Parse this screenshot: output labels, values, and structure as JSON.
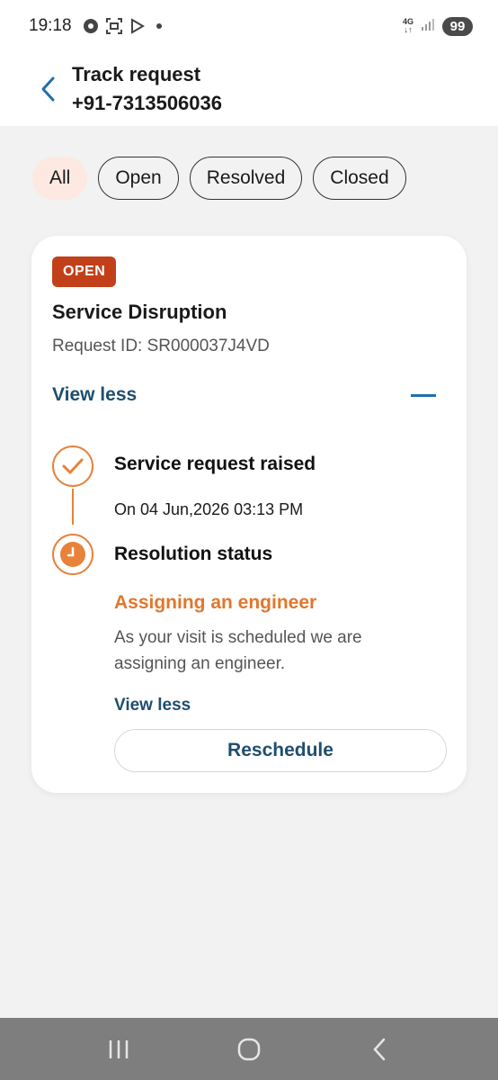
{
  "status_bar": {
    "time": "19:18",
    "network": "4G",
    "battery": "99",
    "icons": [
      "app-icon",
      "scan-icon",
      "play-store-icon",
      "notification-dot",
      "signal-icon"
    ]
  },
  "header": {
    "title": "Track request",
    "subtitle": "+91-7313506036",
    "back_icon": "chevron-left-icon"
  },
  "filters": [
    {
      "label": "All",
      "active": true
    },
    {
      "label": "Open",
      "active": false
    },
    {
      "label": "Resolved",
      "active": false
    },
    {
      "label": "Closed",
      "active": false
    }
  ],
  "card": {
    "badge": "OPEN",
    "title": "Service Disruption",
    "request_id": "Request ID: SR000037J4VD",
    "view_less_label": "View less",
    "timeline": {
      "step1": {
        "title": "Service request raised",
        "date": "On 04 Jun,2026 03:13 PM",
        "icon": "check-icon"
      },
      "step2": {
        "title": "Resolution status",
        "icon": "clock-icon",
        "status_heading": "Assigning an engineer",
        "status_desc": "As your visit is scheduled we are assigning an engineer.",
        "view_less_label": "View less"
      }
    },
    "reschedule_label": "Reschedule"
  },
  "colors": {
    "accent_orange": "#e8823a",
    "badge_red": "#c1401a",
    "link_blue": "#1f4e6e",
    "chip_active_bg": "#fde9e1"
  }
}
